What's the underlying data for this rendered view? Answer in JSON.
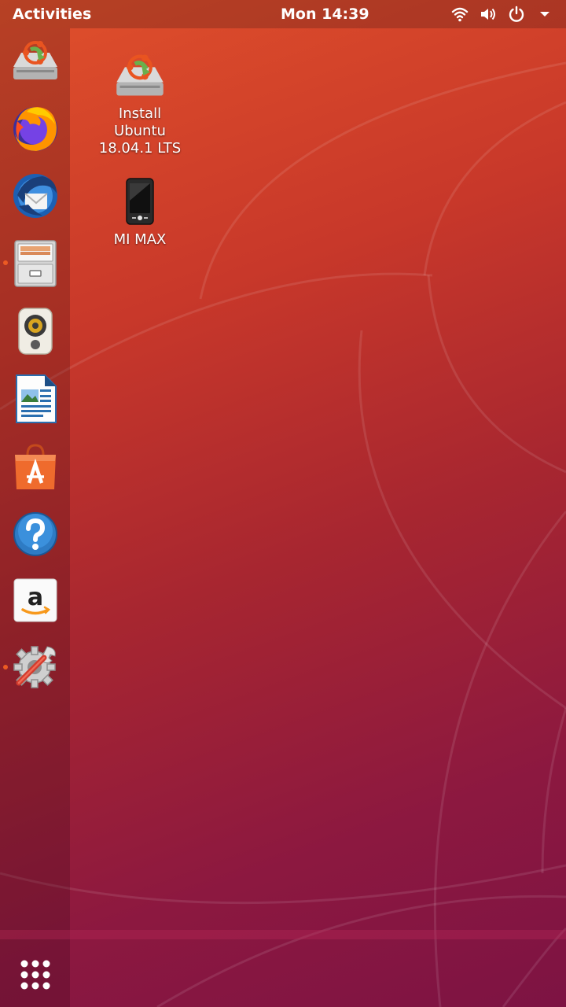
{
  "topbar": {
    "activities_label": "Activities",
    "clock": "Mon 14:39",
    "icons": [
      "wifi-icon",
      "volume-icon",
      "power-icon",
      "menu-arrow-icon"
    ]
  },
  "dock": {
    "items": [
      {
        "name": "install-ubuntu",
        "icon": "installer-icon",
        "running": false
      },
      {
        "name": "firefox",
        "icon": "firefox-icon",
        "running": false
      },
      {
        "name": "thunderbird",
        "icon": "thunderbird-icon",
        "running": false
      },
      {
        "name": "files",
        "icon": "file-cabinet-icon",
        "running": true
      },
      {
        "name": "rhythmbox",
        "icon": "speaker-icon",
        "running": false
      },
      {
        "name": "libreoffice-writer",
        "icon": "writer-document-icon",
        "running": false
      },
      {
        "name": "ubuntu-software",
        "icon": "software-bag-icon",
        "running": false
      },
      {
        "name": "help",
        "icon": "help-icon",
        "running": false
      },
      {
        "name": "amazon",
        "icon": "amazon-icon",
        "running": false
      },
      {
        "name": "settings",
        "icon": "settings-tools-icon",
        "running": true
      }
    ],
    "show_apps_icon": "app-grid-icon"
  },
  "desktop": {
    "icons": [
      {
        "label_line1": "Install",
        "label_line2": "Ubuntu",
        "label_line3": "18.04.1 LTS",
        "icon": "installer-icon"
      },
      {
        "label_line1": "MI MAX",
        "icon": "phone-icon"
      }
    ]
  },
  "colors": {
    "accent": "#e95420",
    "running_dot": "#ec5b23",
    "background_top": "#e0502b",
    "background_bottom": "#7d1343"
  }
}
